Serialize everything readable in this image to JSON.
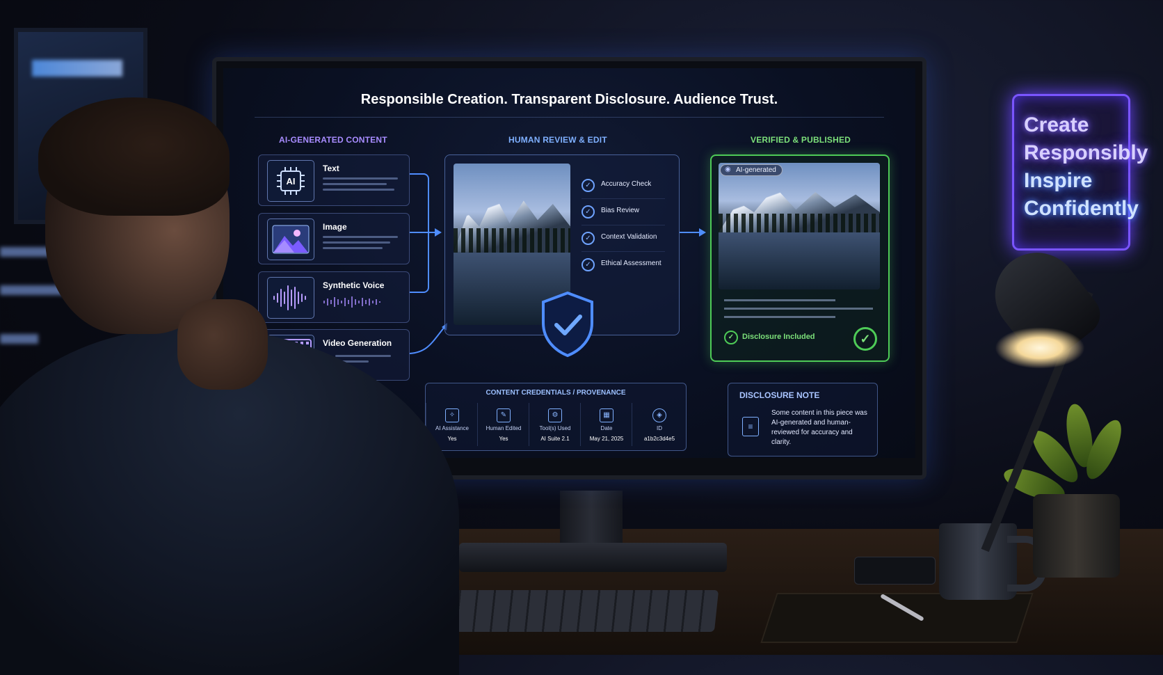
{
  "neon_sign": {
    "lines": [
      "Create",
      "Responsibly",
      "Inspire",
      "Confidently"
    ]
  },
  "screen": {
    "headline": "Responsible Creation. Transparent Disclosure. Audience Trust.",
    "columns": {
      "ai_generated": "AI-GENERATED CONTENT",
      "human_review": "HUMAN REVIEW & EDIT",
      "verified": "VERIFIED & PUBLISHED"
    },
    "sources": [
      {
        "label": "Text",
        "icon": "ai-chip-icon"
      },
      {
        "label": "Image",
        "icon": "image-icon"
      },
      {
        "label": "Synthetic Voice",
        "icon": "waveform-icon"
      },
      {
        "label": "Video Generation",
        "icon": "video-icon"
      }
    ],
    "ai_chip_text": "AI",
    "checks": [
      "Accuracy Check",
      "Bias Review",
      "Context Validation",
      "Ethical Assessment"
    ],
    "verified_tag": "AI-generated",
    "disclosure_included": "Disclosure Included",
    "credentials": {
      "title": "CONTENT CREDENTIALS / PROVENANCE",
      "items": [
        {
          "label": "AI Assistance",
          "value": "Yes"
        },
        {
          "label": "Human Edited",
          "value": "Yes"
        },
        {
          "label": "Tool(s) Used",
          "value": "AI Suite 2.1"
        },
        {
          "label": "Date",
          "value": "May 21, 2025"
        },
        {
          "label": "ID",
          "value": "a1b2c3d4e5"
        }
      ]
    },
    "disclosure_note": {
      "title": "DISCLOSURE NOTE",
      "text": "Some content in this piece was AI-generated and human-reviewed for accuracy and clarity."
    }
  },
  "colors": {
    "accent_blue": "#4f8dff",
    "accent_purple": "#a88cff",
    "accent_green": "#4ecb57"
  }
}
